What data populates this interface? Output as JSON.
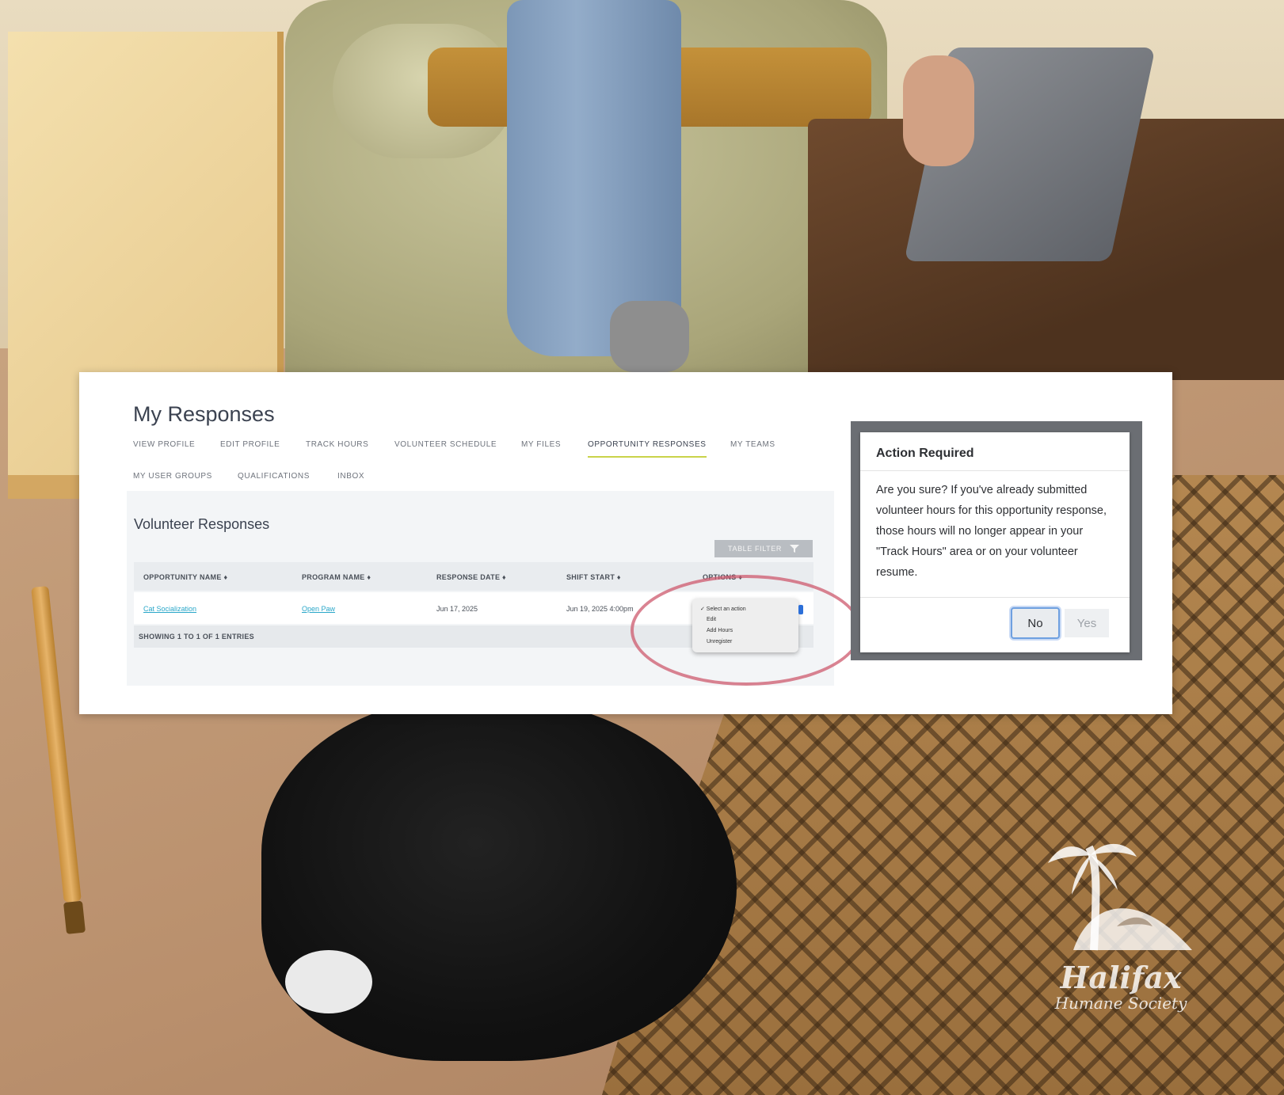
{
  "page": {
    "title": "My Responses",
    "tabs": [
      {
        "label": "VIEW PROFILE"
      },
      {
        "label": "EDIT PROFILE"
      },
      {
        "label": "TRACK HOURS"
      },
      {
        "label": "VOLUNTEER SCHEDULE"
      },
      {
        "label": "MY FILES"
      },
      {
        "label": "OPPORTUNITY RESPONSES",
        "active": true
      },
      {
        "label": "MY TEAMS"
      },
      {
        "label": "MY USER GROUPS"
      },
      {
        "label": "QUALIFICATIONS"
      },
      {
        "label": "INBOX"
      }
    ]
  },
  "responses": {
    "section_title": "Volunteer Responses",
    "table_filter_label": "TABLE FILTER",
    "columns": [
      "OPPORTUNITY NAME ♦",
      "PROGRAM NAME ♦",
      "RESPONSE DATE ♦",
      "SHIFT START ♦",
      "OPTIONS ♦"
    ],
    "rows": [
      {
        "opportunity": "Cat Socialization",
        "program": "Open Paw",
        "response_date": "Jun 17, 2025",
        "shift_start": "Jun 19, 2025 4:00pm"
      }
    ],
    "footer": "SHOWING 1 TO 1 OF 1 ENTRIES",
    "options_menu": [
      "✓ Select an action",
      "Edit",
      "Add Hours",
      "Unregister"
    ]
  },
  "modal": {
    "title": "Action Required",
    "body": "Are you sure? If you've already submitted volunteer hours for this opportunity response, those hours will no longer appear in your \"Track Hours\" area or on your volunteer resume.",
    "no_label": "No",
    "yes_label": "Yes"
  },
  "logo": {
    "name": "Halifax",
    "subtitle": "Humane Society"
  },
  "colors": {
    "accent": "#c9d34a",
    "link": "#2aa7c9",
    "highlight_ring": "#cd5a6e"
  }
}
